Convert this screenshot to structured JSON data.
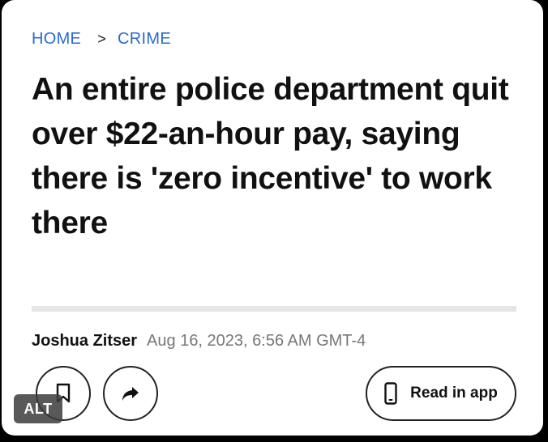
{
  "breadcrumb": {
    "home": "HOME",
    "separator": ">",
    "section": "CRIME"
  },
  "article": {
    "headline": "An entire police department quit over $22-an-hour pay, saying there is 'zero incentive' to work there",
    "author": "Joshua Zitser",
    "date": "Aug 16, 2023, 6:56 AM GMT-4"
  },
  "actions": {
    "bookmark_icon": "bookmark-icon",
    "share_icon": "share-icon",
    "read_in_app_label": "Read in app",
    "read_in_app_icon": "phone-icon"
  },
  "overlay": {
    "alt_label": "ALT"
  },
  "colors": {
    "link": "#2a6bd2",
    "text": "#111111",
    "muted": "#777777",
    "divider": "#e5e5e5"
  }
}
